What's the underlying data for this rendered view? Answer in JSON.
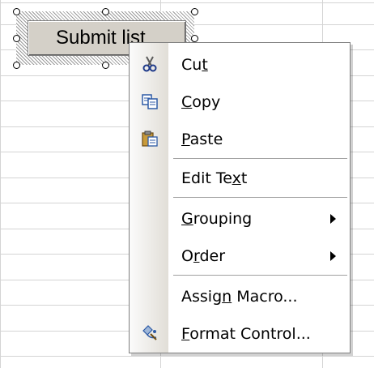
{
  "control": {
    "button_label": "Submit list"
  },
  "menu": {
    "items": [
      {
        "id": "cut",
        "pre": "Cu",
        "ul": "t",
        "post": "",
        "icon": "scissors-icon"
      },
      {
        "id": "copy",
        "pre": "",
        "ul": "C",
        "post": "opy",
        "icon": "copy-icon"
      },
      {
        "id": "paste",
        "pre": "",
        "ul": "P",
        "post": "aste",
        "icon": "paste-icon"
      },
      {
        "id": "edit-text",
        "pre": "Edit Te",
        "ul": "x",
        "post": "t",
        "icon": ""
      },
      {
        "id": "grouping",
        "pre": "",
        "ul": "G",
        "post": "rouping",
        "icon": "",
        "submenu": true
      },
      {
        "id": "order",
        "pre": "O",
        "ul": "r",
        "post": "der",
        "icon": "",
        "submenu": true
      },
      {
        "id": "assign-macro",
        "pre": "Assig",
        "ul": "n",
        "post": " Macro...",
        "icon": ""
      },
      {
        "id": "format-control",
        "pre": "",
        "ul": "F",
        "post": "ormat Control...",
        "icon": "format-control-icon"
      }
    ]
  },
  "colors": {
    "menu_background": "#ffffff",
    "icon_column": "#e1ded7",
    "button_face": "#d4d0c8",
    "grid_line": "#d4d4d4"
  }
}
